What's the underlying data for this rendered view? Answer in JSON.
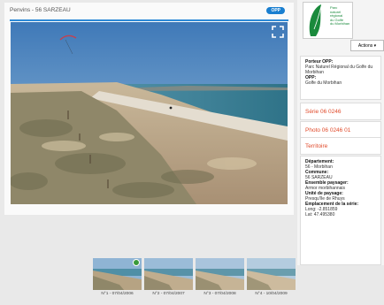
{
  "viewer": {
    "title": "Penvins - 56 SARZEAU",
    "badge": "OPP"
  },
  "sidebar": {
    "logo": {
      "line1": "Parc",
      "line2": "naturel",
      "line3": "régional",
      "line4": "du Golfe",
      "line5": "du Morbihan"
    },
    "actions_label": "Actions ▾",
    "porteur_label": "Porteur OPP:",
    "porteur_value": "Parc Naturel Régional du Golfe du Morbihan",
    "opp_label": "OPP:",
    "opp_value": "Golfe du Morbihan",
    "serie": "Série 06 0246",
    "photo": "Photo 06 0246 01",
    "territoire": "Territoire",
    "departement_label": "Département:",
    "departement_value": "56 - Morbihan",
    "commune_label": "Commune:",
    "commune_value": "56 SARZEAU",
    "ensemble_label": "Ensemble paysager:",
    "ensemble_value": "Armor morbihannais",
    "unite_label": "Unité de paysage:",
    "unite_value": "Presqu'île de Rhuys",
    "emplacement_label": "Emplacement de la série:",
    "long_value": "Long: -2.851859",
    "lat_value": "Lat: 47.495380"
  },
  "thumbnails": [
    {
      "caption": "N°1 - 07/04/2006",
      "selected": true
    },
    {
      "caption": "N°2 - 07/04/2007",
      "selected": false
    },
    {
      "caption": "N°3 - 07/04/2008",
      "selected": false
    },
    {
      "caption": "N°4 - 10/04/2009",
      "selected": false
    }
  ],
  "colors": {
    "accent": "#2d8ad8",
    "link_red": "#e04a2a",
    "logo_green": "#1a8a3c"
  }
}
